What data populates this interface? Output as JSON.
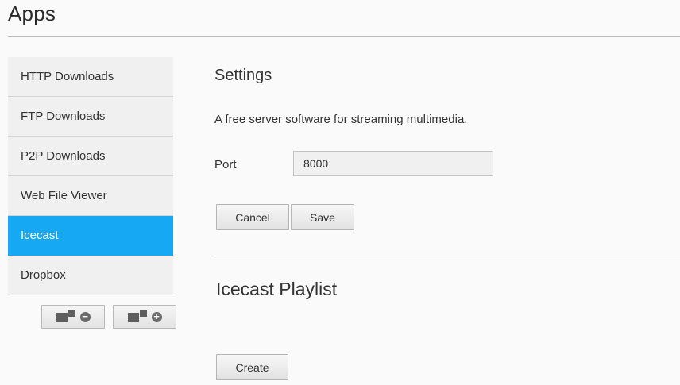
{
  "header": {
    "title": "Apps"
  },
  "sidebar": {
    "items": [
      {
        "label": "HTTP Downloads"
      },
      {
        "label": "FTP Downloads"
      },
      {
        "label": "P2P Downloads"
      },
      {
        "label": "Web File Viewer"
      },
      {
        "label": "Icecast",
        "active": true
      },
      {
        "label": "Dropbox"
      }
    ],
    "remove_icon": "app-remove-icon",
    "add_icon": "app-add-icon"
  },
  "settings": {
    "title": "Settings",
    "description": "A free server software for streaming multimedia.",
    "port_label": "Port",
    "port_value": "8000",
    "cancel_label": "Cancel",
    "save_label": "Save"
  },
  "playlist": {
    "title": "Icecast Playlist",
    "create_label": "Create"
  },
  "colors": {
    "accent": "#17a8f4",
    "sidebar_bg": "#f0f0f0",
    "page_bg": "#fafafa"
  }
}
